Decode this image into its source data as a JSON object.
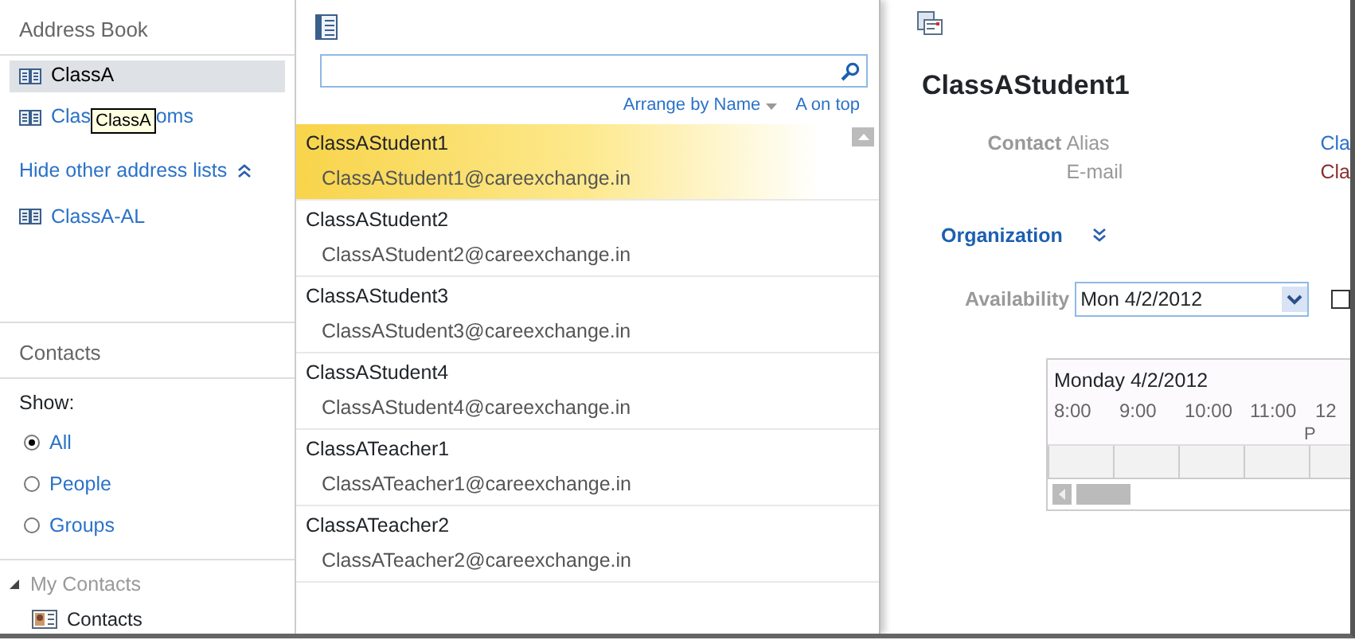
{
  "address_book": {
    "title": "Address Book",
    "lists": [
      {
        "label": "ClassA",
        "selected": true
      },
      {
        "label_parts": [
          "Clas",
          "oms"
        ],
        "selected": false
      }
    ],
    "tooltip": "ClassA",
    "hide_link": "Hide other address lists",
    "other_lists": [
      {
        "label": "ClassA-AL",
        "selected": false
      }
    ]
  },
  "contacts_pane": {
    "title": "Contacts",
    "show_label": "Show:",
    "filters": [
      {
        "label": "All",
        "selected": true
      },
      {
        "label": "People",
        "selected": false
      },
      {
        "label": "Groups",
        "selected": false
      }
    ],
    "tree": [
      {
        "label": "My Contacts",
        "expanded": true,
        "children": [
          {
            "label": "Contacts"
          }
        ]
      }
    ]
  },
  "list": {
    "arrange": "Arrange by Name",
    "order": "A on top",
    "contacts": [
      {
        "name": "ClassAStudent1",
        "email": "ClassAStudent1@careexchange.in",
        "selected": true
      },
      {
        "name": "ClassAStudent2",
        "email": "ClassAStudent2@careexchange.in",
        "selected": false
      },
      {
        "name": "ClassAStudent3",
        "email": "ClassAStudent3@careexchange.in",
        "selected": false
      },
      {
        "name": "ClassAStudent4",
        "email": "ClassAStudent4@careexchange.in",
        "selected": false
      },
      {
        "name": "ClassATeacher1",
        "email": "ClassATeacher1@careexchange.in",
        "selected": false
      },
      {
        "name": "ClassATeacher2",
        "email": "ClassATeacher2@careexchange.in",
        "selected": false
      }
    ]
  },
  "details": {
    "name": "ClassAStudent1",
    "section_label": "Contact",
    "fields": [
      {
        "label": "Alias",
        "value": "Cla",
        "kind": "link"
      },
      {
        "label": "E-mail",
        "value": "Cla",
        "kind": "text"
      }
    ],
    "organization": "Organization",
    "availability_label": "Availability",
    "date": "Mon 4/2/2012",
    "checkbox": {
      "checked": false
    },
    "calendar": {
      "day": "Monday 4/2/2012",
      "hours": [
        "8:00",
        "9:00",
        "10:00",
        "11:00",
        "12"
      ],
      "suffix": "P"
    }
  }
}
